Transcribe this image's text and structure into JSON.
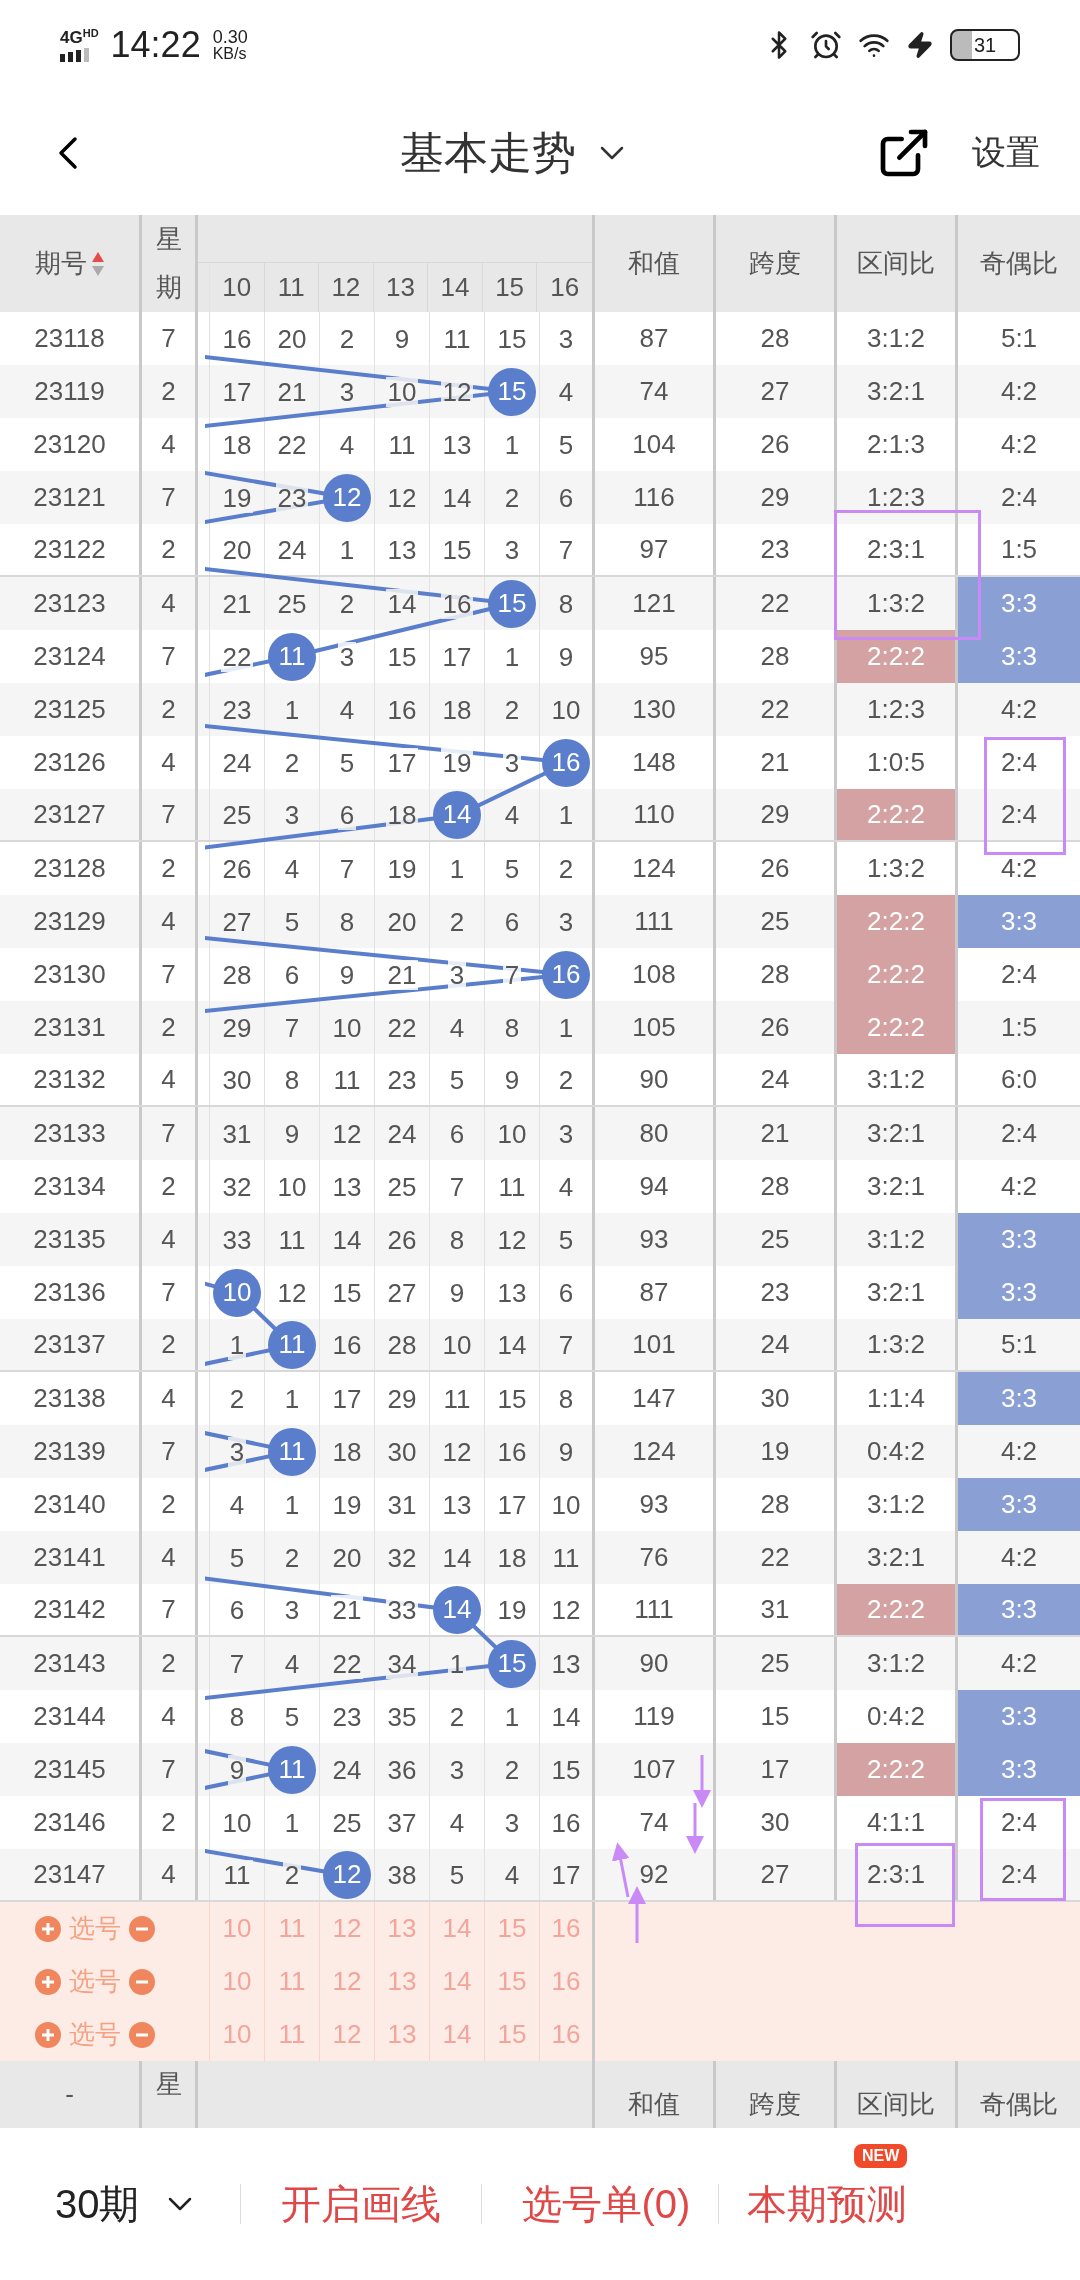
{
  "status_bar": {
    "network": "4G",
    "network_sub": "HD",
    "time": "14:22",
    "speed": "0.30",
    "speed_unit": "KB/s",
    "battery": "31"
  },
  "nav": {
    "title": "基本走势",
    "settings": "设置"
  },
  "table": {
    "sorted": true,
    "columns": {
      "period": "期号",
      "weekday_top": "星",
      "weekday_bottom": "期",
      "numbers": [
        "10",
        "11",
        "12",
        "13",
        "14",
        "15",
        "16"
      ],
      "sum": "和值",
      "span": "跨度",
      "zone": "区间比",
      "parity": "奇偶比"
    },
    "rows": [
      {
        "period": "23118",
        "weekday": "7",
        "cells": [
          "16",
          "20",
          "2",
          "9",
          "11",
          "15",
          "3"
        ],
        "hit": [
          false,
          false,
          false,
          false,
          false,
          false,
          false
        ],
        "sum": "87",
        "span": "28",
        "zone": "3:1:2",
        "zone_hl": false,
        "parity": "5:1",
        "parity_hl": false
      },
      {
        "period": "23119",
        "weekday": "2",
        "cells": [
          "17",
          "21",
          "3",
          "10",
          "12",
          "15",
          "4"
        ],
        "hit": [
          false,
          false,
          false,
          false,
          false,
          true,
          false
        ],
        "sum": "74",
        "span": "27",
        "zone": "3:2:1",
        "zone_hl": false,
        "parity": "4:2",
        "parity_hl": false
      },
      {
        "period": "23120",
        "weekday": "4",
        "cells": [
          "18",
          "22",
          "4",
          "11",
          "13",
          "1",
          "5"
        ],
        "hit": [
          false,
          false,
          false,
          false,
          false,
          false,
          false
        ],
        "sum": "104",
        "span": "26",
        "zone": "2:1:3",
        "zone_hl": false,
        "parity": "4:2",
        "parity_hl": false
      },
      {
        "period": "23121",
        "weekday": "7",
        "cells": [
          "19",
          "23",
          "12",
          "12",
          "14",
          "2",
          "6"
        ],
        "hit": [
          false,
          false,
          true,
          false,
          false,
          false,
          false
        ],
        "sum": "116",
        "span": "29",
        "zone": "1:2:3",
        "zone_hl": false,
        "parity": "2:4",
        "parity_hl": false
      },
      {
        "period": "23122",
        "weekday": "2",
        "cells": [
          "20",
          "24",
          "1",
          "13",
          "15",
          "3",
          "7"
        ],
        "hit": [
          false,
          false,
          false,
          false,
          false,
          false,
          false
        ],
        "sum": "97",
        "span": "23",
        "zone": "2:3:1",
        "zone_hl": false,
        "parity": "1:5",
        "parity_hl": false
      },
      {
        "period": "23123",
        "weekday": "4",
        "cells": [
          "21",
          "25",
          "2",
          "14",
          "16",
          "15",
          "8"
        ],
        "hit": [
          false,
          false,
          false,
          false,
          false,
          true,
          false
        ],
        "sum": "121",
        "span": "22",
        "zone": "1:3:2",
        "zone_hl": false,
        "parity": "3:3",
        "parity_hl": true
      },
      {
        "period": "23124",
        "weekday": "7",
        "cells": [
          "22",
          "11",
          "3",
          "15",
          "17",
          "1",
          "9"
        ],
        "hit": [
          false,
          true,
          false,
          false,
          false,
          false,
          false
        ],
        "sum": "95",
        "span": "28",
        "zone": "2:2:2",
        "zone_hl": true,
        "parity": "3:3",
        "parity_hl": true
      },
      {
        "period": "23125",
        "weekday": "2",
        "cells": [
          "23",
          "1",
          "4",
          "16",
          "18",
          "2",
          "10"
        ],
        "hit": [
          false,
          false,
          false,
          false,
          false,
          false,
          false
        ],
        "sum": "130",
        "span": "22",
        "zone": "1:2:3",
        "zone_hl": false,
        "parity": "4:2",
        "parity_hl": false
      },
      {
        "period": "23126",
        "weekday": "4",
        "cells": [
          "24",
          "2",
          "5",
          "17",
          "19",
          "3",
          "16"
        ],
        "hit": [
          false,
          false,
          false,
          false,
          false,
          false,
          true
        ],
        "sum": "148",
        "span": "21",
        "zone": "1:0:5",
        "zone_hl": false,
        "parity": "2:4",
        "parity_hl": false
      },
      {
        "period": "23127",
        "weekday": "7",
        "cells": [
          "25",
          "3",
          "6",
          "18",
          "14",
          "4",
          "1"
        ],
        "hit": [
          false,
          false,
          false,
          false,
          true,
          false,
          false
        ],
        "sum": "110",
        "span": "29",
        "zone": "2:2:2",
        "zone_hl": true,
        "parity": "2:4",
        "parity_hl": false
      },
      {
        "period": "23128",
        "weekday": "2",
        "cells": [
          "26",
          "4",
          "7",
          "19",
          "1",
          "5",
          "2"
        ],
        "hit": [
          false,
          false,
          false,
          false,
          false,
          false,
          false
        ],
        "sum": "124",
        "span": "26",
        "zone": "1:3:2",
        "zone_hl": false,
        "parity": "4:2",
        "parity_hl": false
      },
      {
        "period": "23129",
        "weekday": "4",
        "cells": [
          "27",
          "5",
          "8",
          "20",
          "2",
          "6",
          "3"
        ],
        "hit": [
          false,
          false,
          false,
          false,
          false,
          false,
          false
        ],
        "sum": "111",
        "span": "25",
        "zone": "2:2:2",
        "zone_hl": true,
        "parity": "3:3",
        "parity_hl": true
      },
      {
        "period": "23130",
        "weekday": "7",
        "cells": [
          "28",
          "6",
          "9",
          "21",
          "3",
          "7",
          "16"
        ],
        "hit": [
          false,
          false,
          false,
          false,
          false,
          false,
          true
        ],
        "sum": "108",
        "span": "28",
        "zone": "2:2:2",
        "zone_hl": true,
        "parity": "2:4",
        "parity_hl": false
      },
      {
        "period": "23131",
        "weekday": "2",
        "cells": [
          "29",
          "7",
          "10",
          "22",
          "4",
          "8",
          "1"
        ],
        "hit": [
          false,
          false,
          false,
          false,
          false,
          false,
          false
        ],
        "sum": "105",
        "span": "26",
        "zone": "2:2:2",
        "zone_hl": true,
        "parity": "1:5",
        "parity_hl": false
      },
      {
        "period": "23132",
        "weekday": "4",
        "cells": [
          "30",
          "8",
          "11",
          "23",
          "5",
          "9",
          "2"
        ],
        "hit": [
          false,
          false,
          false,
          false,
          false,
          false,
          false
        ],
        "sum": "90",
        "span": "24",
        "zone": "3:1:2",
        "zone_hl": false,
        "parity": "6:0",
        "parity_hl": false
      },
      {
        "period": "23133",
        "weekday": "7",
        "cells": [
          "31",
          "9",
          "12",
          "24",
          "6",
          "10",
          "3"
        ],
        "hit": [
          false,
          false,
          false,
          false,
          false,
          false,
          false
        ],
        "sum": "80",
        "span": "21",
        "zone": "3:2:1",
        "zone_hl": false,
        "parity": "2:4",
        "parity_hl": false
      },
      {
        "period": "23134",
        "weekday": "2",
        "cells": [
          "32",
          "10",
          "13",
          "25",
          "7",
          "11",
          "4"
        ],
        "hit": [
          false,
          false,
          false,
          false,
          false,
          false,
          false
        ],
        "sum": "94",
        "span": "28",
        "zone": "3:2:1",
        "zone_hl": false,
        "parity": "4:2",
        "parity_hl": false
      },
      {
        "period": "23135",
        "weekday": "4",
        "cells": [
          "33",
          "11",
          "14",
          "26",
          "8",
          "12",
          "5"
        ],
        "hit": [
          false,
          false,
          false,
          false,
          false,
          false,
          false
        ],
        "sum": "93",
        "span": "25",
        "zone": "3:1:2",
        "zone_hl": false,
        "parity": "3:3",
        "parity_hl": true
      },
      {
        "period": "23136",
        "weekday": "7",
        "cells": [
          "10",
          "12",
          "15",
          "27",
          "9",
          "13",
          "6"
        ],
        "hit": [
          true,
          false,
          false,
          false,
          false,
          false,
          false
        ],
        "sum": "87",
        "span": "23",
        "zone": "3:2:1",
        "zone_hl": false,
        "parity": "3:3",
        "parity_hl": true
      },
      {
        "period": "23137",
        "weekday": "2",
        "cells": [
          "1",
          "11",
          "16",
          "28",
          "10",
          "14",
          "7"
        ],
        "hit": [
          false,
          true,
          false,
          false,
          false,
          false,
          false
        ],
        "sum": "101",
        "span": "24",
        "zone": "1:3:2",
        "zone_hl": false,
        "parity": "5:1",
        "parity_hl": false
      },
      {
        "period": "23138",
        "weekday": "4",
        "cells": [
          "2",
          "1",
          "17",
          "29",
          "11",
          "15",
          "8"
        ],
        "hit": [
          false,
          false,
          false,
          false,
          false,
          false,
          false
        ],
        "sum": "147",
        "span": "30",
        "zone": "1:1:4",
        "zone_hl": false,
        "parity": "3:3",
        "parity_hl": true
      },
      {
        "period": "23139",
        "weekday": "7",
        "cells": [
          "3",
          "11",
          "18",
          "30",
          "12",
          "16",
          "9"
        ],
        "hit": [
          false,
          true,
          false,
          false,
          false,
          false,
          false
        ],
        "sum": "124",
        "span": "19",
        "zone": "0:4:2",
        "zone_hl": false,
        "parity": "4:2",
        "parity_hl": false
      },
      {
        "period": "23140",
        "weekday": "2",
        "cells": [
          "4",
          "1",
          "19",
          "31",
          "13",
          "17",
          "10"
        ],
        "hit": [
          false,
          false,
          false,
          false,
          false,
          false,
          false
        ],
        "sum": "93",
        "span": "28",
        "zone": "3:1:2",
        "zone_hl": false,
        "parity": "3:3",
        "parity_hl": true
      },
      {
        "period": "23141",
        "weekday": "4",
        "cells": [
          "5",
          "2",
          "20",
          "32",
          "14",
          "18",
          "11"
        ],
        "hit": [
          false,
          false,
          false,
          false,
          false,
          false,
          false
        ],
        "sum": "76",
        "span": "22",
        "zone": "3:2:1",
        "zone_hl": false,
        "parity": "4:2",
        "parity_hl": false
      },
      {
        "period": "23142",
        "weekday": "7",
        "cells": [
          "6",
          "3",
          "21",
          "33",
          "14",
          "19",
          "12"
        ],
        "hit": [
          false,
          false,
          false,
          false,
          true,
          false,
          false
        ],
        "sum": "111",
        "span": "31",
        "zone": "2:2:2",
        "zone_hl": true,
        "parity": "3:3",
        "parity_hl": true
      },
      {
        "period": "23143",
        "weekday": "2",
        "cells": [
          "7",
          "4",
          "22",
          "34",
          "1",
          "15",
          "13"
        ],
        "hit": [
          false,
          false,
          false,
          false,
          false,
          true,
          false
        ],
        "sum": "90",
        "span": "25",
        "zone": "3:1:2",
        "zone_hl": false,
        "parity": "4:2",
        "parity_hl": false
      },
      {
        "period": "23144",
        "weekday": "4",
        "cells": [
          "8",
          "5",
          "23",
          "35",
          "2",
          "1",
          "14"
        ],
        "hit": [
          false,
          false,
          false,
          false,
          false,
          false,
          false
        ],
        "sum": "119",
        "span": "15",
        "zone": "0:4:2",
        "zone_hl": false,
        "parity": "3:3",
        "parity_hl": true
      },
      {
        "period": "23145",
        "weekday": "7",
        "cells": [
          "9",
          "11",
          "24",
          "36",
          "3",
          "2",
          "15"
        ],
        "hit": [
          false,
          true,
          false,
          false,
          false,
          false,
          false
        ],
        "sum": "107",
        "span": "17",
        "zone": "2:2:2",
        "zone_hl": true,
        "parity": "3:3",
        "parity_hl": true
      },
      {
        "period": "23146",
        "weekday": "2",
        "cells": [
          "10",
          "1",
          "25",
          "37",
          "4",
          "3",
          "16"
        ],
        "hit": [
          false,
          false,
          false,
          false,
          false,
          false,
          false
        ],
        "sum": "74",
        "span": "30",
        "zone": "4:1:1",
        "zone_hl": false,
        "parity": "2:4",
        "parity_hl": false
      },
      {
        "period": "23147",
        "weekday": "4",
        "cells": [
          "11",
          "2",
          "12",
          "38",
          "5",
          "4",
          "17"
        ],
        "hit": [
          false,
          false,
          true,
          false,
          false,
          false,
          false
        ],
        "sum": "92",
        "span": "27",
        "zone": "2:3:1",
        "zone_hl": false,
        "parity": "2:4",
        "parity_hl": false
      }
    ],
    "pick_rows": [
      {
        "label": "选号",
        "numbers": [
          "10",
          "11",
          "12",
          "13",
          "14",
          "15",
          "16"
        ]
      },
      {
        "label": "选号",
        "numbers": [
          "10",
          "11",
          "12",
          "13",
          "14",
          "15",
          "16"
        ]
      },
      {
        "label": "选号",
        "numbers": [
          "10",
          "11",
          "12",
          "13",
          "14",
          "15",
          "16"
        ]
      }
    ],
    "footer_header": {
      "period": "-",
      "weekday_top": "星",
      "sum": "和值",
      "span": "跨度",
      "zone": "区间比",
      "parity": "奇偶比"
    }
  },
  "bottom_bar": {
    "periods": "30期",
    "draw_lines": "开启画线",
    "pick_list": "选号单(0)",
    "predict": "本期预测",
    "badge": "NEW"
  }
}
